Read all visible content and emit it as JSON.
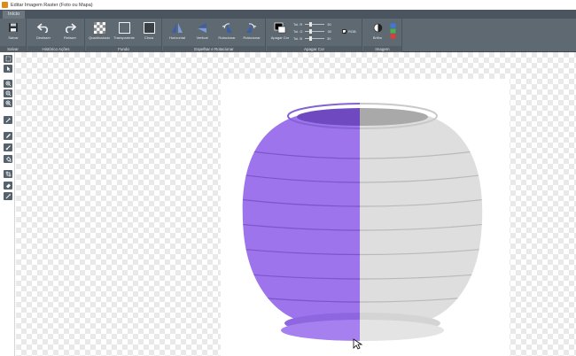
{
  "window": {
    "title": "Editar Imagem Raster (Foto ou Mapa)"
  },
  "tabs": [
    {
      "label": "Início"
    }
  ],
  "ribbon": {
    "groups": [
      {
        "label": "Salvar",
        "buttons": [
          {
            "label": "Salvar",
            "icon": "floppy-disk-icon"
          }
        ]
      },
      {
        "label": "Histórico Ações",
        "buttons": [
          {
            "label": "Desfazer",
            "icon": "undo-icon"
          },
          {
            "label": "Refazer",
            "icon": "redo-icon"
          }
        ]
      },
      {
        "label": "Fundo",
        "buttons": [
          {
            "label": "Quadriculado",
            "icon": "checker-icon"
          },
          {
            "label": "Transparente",
            "icon": "transparent-icon"
          },
          {
            "label": "Cinza",
            "icon": "gray-square-icon"
          }
        ]
      },
      {
        "label": "Espelhar e Rotacionar",
        "buttons": [
          {
            "label": "Horizontal",
            "icon": "flip-horizontal-icon"
          },
          {
            "label": "Vertical",
            "icon": "flip-vertical-icon"
          },
          {
            "label": "Rotacionar",
            "icon": "rotate-left-icon"
          },
          {
            "label": "Rotacionar",
            "icon": "rotate-right-icon"
          }
        ]
      },
      {
        "label": "Apagar Cor",
        "buttons": [
          {
            "label": "Apagar Cor",
            "icon": "color-swatch-icon"
          }
        ],
        "sliders": [
          {
            "label": "Tol. R",
            "value": "30"
          },
          {
            "label": "Tol. G",
            "value": "30"
          },
          {
            "label": "Tol. B",
            "value": "30"
          }
        ],
        "checkbox": {
          "label": "RGB",
          "checked": true
        }
      },
      {
        "label": "Imagem",
        "buttons": [
          {
            "label": "Brilho",
            "icon": "brightness-icon"
          }
        ]
      }
    ]
  },
  "toolbox": {
    "tools": [
      "select-icon",
      "pointer-icon",
      "zoom-in-icon",
      "zoom-out-icon",
      "zoom-fit-icon",
      "eyedropper-icon",
      "pencil-icon",
      "brush-icon",
      "fill-icon",
      "crop-icon",
      "eraser-icon",
      "magic-wand-icon"
    ]
  },
  "colors": {
    "ribbon": "#5e6972",
    "tab_active": "#6b767f",
    "pot_purple": "#9b72ea",
    "pot_gray": "#dcdcdc"
  }
}
